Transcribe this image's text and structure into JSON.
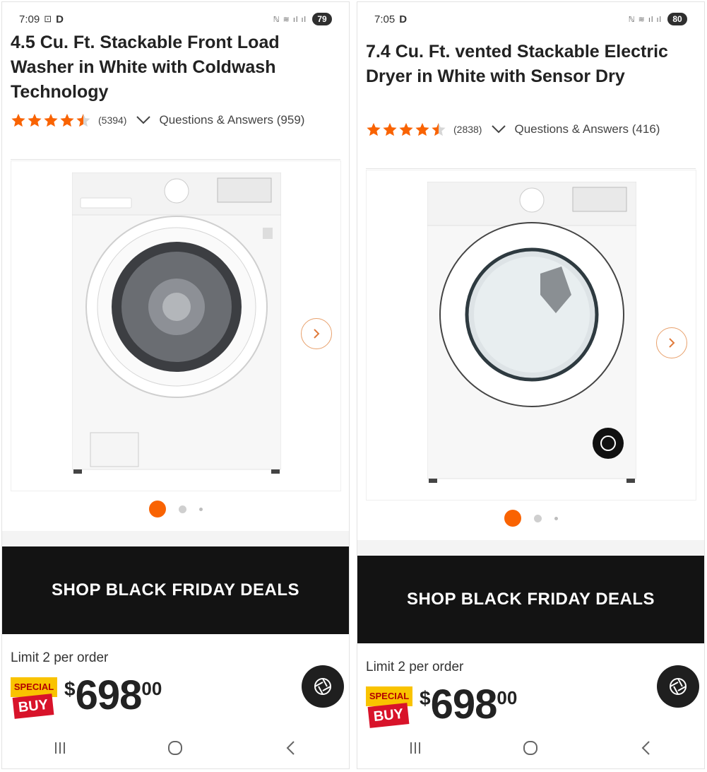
{
  "screens": [
    {
      "status": {
        "time": "7:09",
        "indicator": "D",
        "battery": "79"
      },
      "product": {
        "title": "4.5 Cu. Ft. Stackable Front Load Washer in White with Coldwash Technology",
        "rating": 4.5,
        "reviews": "(5394)",
        "qa_label": "Questions & Answers (959)"
      },
      "banner_label": "SHOP BLACK FRIDAY DEALS",
      "limit_text": "Limit 2 per order",
      "badge": {
        "top": "SPECIAL",
        "bottom": "BUY"
      },
      "price": {
        "currency": "$",
        "dollars": "698",
        "cents": "00"
      }
    },
    {
      "status": {
        "time": "7:05",
        "indicator": "D",
        "battery": "80"
      },
      "product": {
        "title": "7.4 Cu. Ft. vented Stackable Electric Dryer in White with Sensor Dry",
        "rating": 4.5,
        "reviews": "(2838)",
        "qa_label": "Questions & Answers (416)"
      },
      "banner_label": "SHOP BLACK FRIDAY DEALS",
      "limit_text": "Limit 2 per order",
      "badge": {
        "top": "SPECIAL",
        "bottom": "BUY"
      },
      "price": {
        "currency": "$",
        "dollars": "698",
        "cents": "00"
      }
    }
  ],
  "colors": {
    "accent": "#f96302",
    "star": "#f96302",
    "banner_bg": "#131313",
    "badge_red": "#d8132a",
    "badge_yellow": "#f9c300"
  },
  "icons": [
    "star-icon",
    "chevron-down-icon",
    "chevron-right-icon",
    "camera-aperture-icon",
    "recent-apps-icon",
    "home-icon",
    "back-icon",
    "battery-icon",
    "wifi-icon",
    "signal-icon"
  ]
}
